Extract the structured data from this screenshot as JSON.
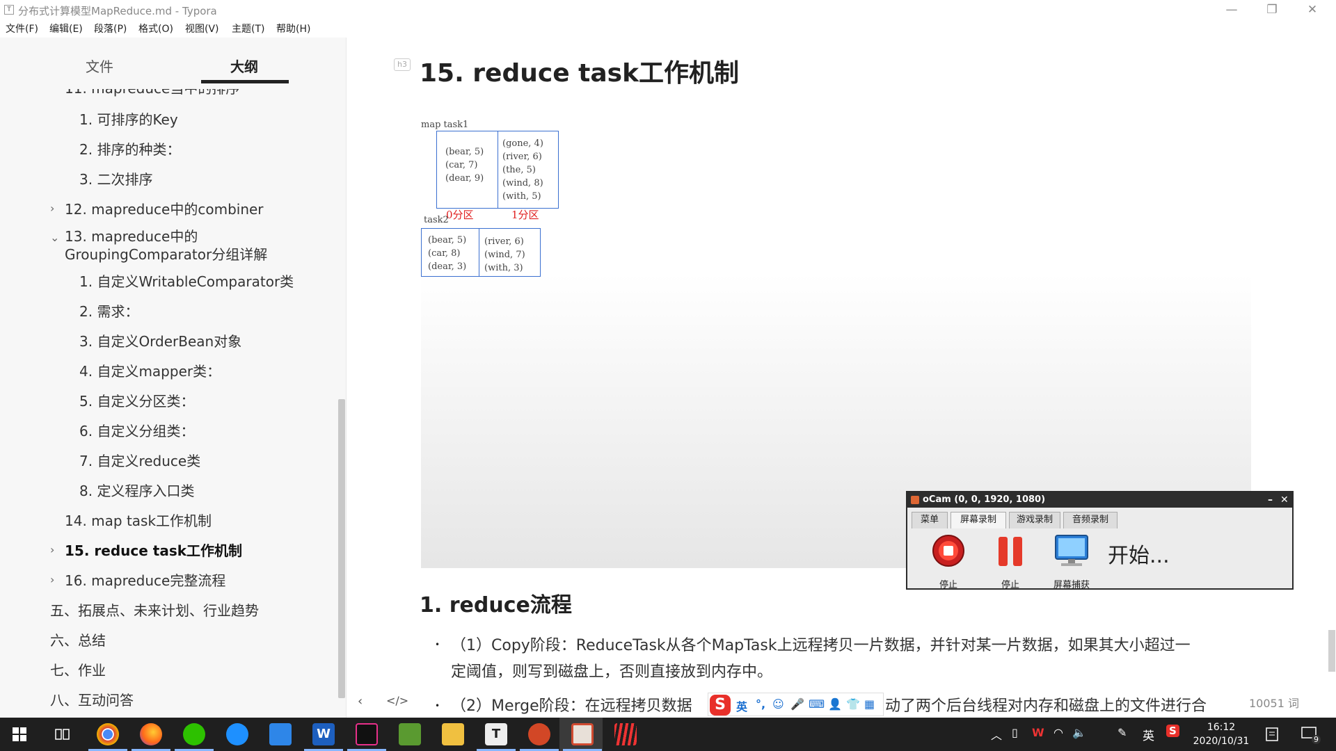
{
  "window": {
    "icon": "T",
    "title": "分布式计算模型MapReduce.md - Typora",
    "controls": {
      "minimize": "—",
      "restore": "❐",
      "close": "✕"
    }
  },
  "menu": [
    "文件(F)",
    "编辑(E)",
    "段落(P)",
    "格式(O)",
    "视图(V)",
    "主题(T)",
    "帮助(H)"
  ],
  "sidebar": {
    "tabs": {
      "files": "文件",
      "outline": "大纲"
    },
    "outline": [
      {
        "label": "11. mapreduce当中的排序"
      },
      {
        "label": "1. 可排序的Key"
      },
      {
        "label": "2. 排序的种类："
      },
      {
        "label": "3. 二次排序"
      },
      {
        "label": "12. mapreduce中的combiner",
        "chevron": "›"
      },
      {
        "label": "13. mapreduce中的",
        "label2": "GroupingComparator分组详解",
        "chevron": "⌄"
      },
      {
        "label": "1. 自定义WritableComparator类"
      },
      {
        "label": "2. 需求："
      },
      {
        "label": "3. 自定义OrderBean对象"
      },
      {
        "label": "4. 自定义mapper类："
      },
      {
        "label": "5. 自定义分区类："
      },
      {
        "label": "6. 自定义分组类："
      },
      {
        "label": "7. 自定义reduce类"
      },
      {
        "label": "8. 定义程序入口类"
      },
      {
        "label": "14. map task工作机制"
      },
      {
        "label": "15. reduce task工作机制",
        "chevron": "›",
        "active": true
      },
      {
        "label": "16. mapreduce完整流程",
        "chevron": "›"
      },
      {
        "label": "五、拓展点、未来计划、行业趋势"
      },
      {
        "label": "六、总结"
      },
      {
        "label": "七、作业"
      },
      {
        "label": "八、互动问答"
      }
    ]
  },
  "content": {
    "heading_badge": "h3",
    "heading": "15. reduce task工作机制",
    "diagram": {
      "map_label": "map task1",
      "map_box_left": "(bear, 5)\n(car, 7)\n(dear, 9)",
      "map_box_right": "(gone, 4)\n(river, 6)\n(the, 5)\n(wind, 8)\n(with, 5)",
      "partition0": "0分区",
      "partition1": "1分区",
      "task_label": "task2",
      "task_box_left": "(bear, 5)\n(car, 8)\n(dear, 3)",
      "task_box_right": "(river, 6)\n(wind, 7)\n(with, 3)"
    },
    "subheading": "1. reduce流程",
    "bullets": [
      {
        "marker": "•",
        "line1": "（1）Copy阶段：ReduceTask从各个MapTask上远程拷贝一片数据，并针对某一片数据，如果其大小超过一",
        "line2": "定阈值，则写到磁盘上，否则直接放到内存中。"
      },
      {
        "marker": "•",
        "line1_a": "（2）Merge阶段：在远程拷贝数据",
        "line1_b": "动了两个后台线程对内存和磁盘上的文件进行合"
      }
    ]
  },
  "footer": {
    "back": "‹",
    "source": "</>",
    "wordcount": "10051 词"
  },
  "ocam": {
    "title": "oCam (0, 0, 1920, 1080)",
    "min": "–",
    "close": "✕",
    "tabs": [
      "菜单",
      "屏幕录制",
      "游戏录制",
      "音频录制"
    ],
    "buttons": [
      "停止",
      "停止",
      "屏幕捕获"
    ],
    "status": "开始..."
  },
  "ime": {
    "logo": "S",
    "items": [
      "英",
      "°,",
      "☺",
      "🎤",
      "⌨",
      "👤",
      "👕",
      "▦"
    ]
  },
  "taskbar": {
    "tray": [
      "︿",
      "▯",
      "W",
      "◠",
      "🔈",
      "✎",
      "英",
      "S"
    ],
    "time": "16:12",
    "date": "2020/10/31",
    "notif_count": "9"
  },
  "colors": {
    "diagram_border": "#3a6fd0",
    "partition_text": "#e02020",
    "accent_underline": "#222222",
    "taskbar": "#1f1f1f"
  }
}
